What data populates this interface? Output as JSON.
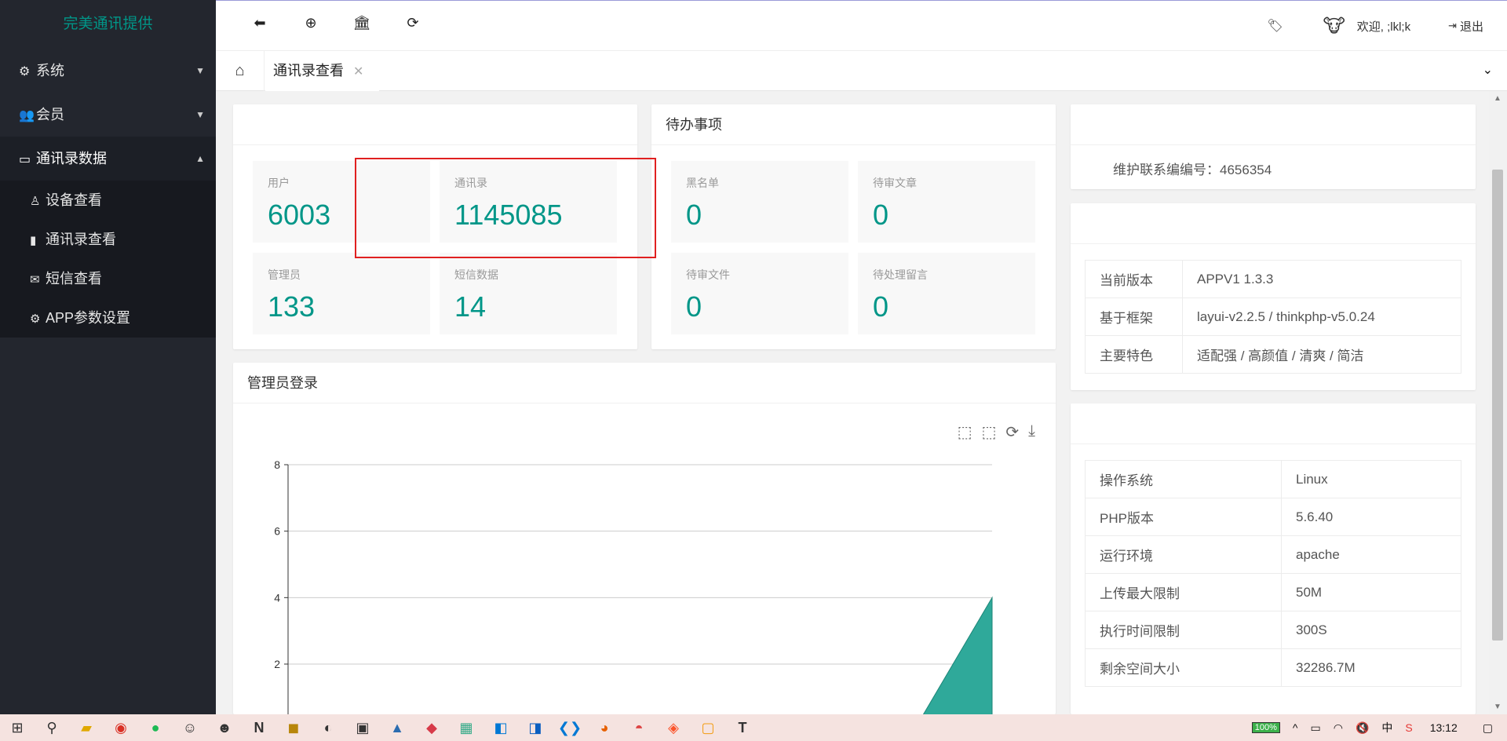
{
  "brand": "完美通讯提供",
  "sidebar": {
    "items": [
      {
        "label": "系统",
        "icon": "gear-icon"
      },
      {
        "label": "会员",
        "icon": "users-icon"
      },
      {
        "label": "通讯录数据",
        "icon": "id-card-icon"
      }
    ],
    "subitems": [
      {
        "label": "设备查看",
        "icon": "user-icon"
      },
      {
        "label": "通讯录查看",
        "icon": "building-icon"
      },
      {
        "label": "短信查看",
        "icon": "envelope-icon"
      },
      {
        "label": "APP参数设置",
        "icon": "gear-icon"
      }
    ]
  },
  "header": {
    "welcome": "欢迎, ;lkl;k",
    "logout": "退出"
  },
  "tabs": {
    "active": "通讯录查看"
  },
  "stats": [
    {
      "label": "用户",
      "value": "6003"
    },
    {
      "label": "通讯录",
      "value": "1145085"
    },
    {
      "label": "管理员",
      "value": "133"
    },
    {
      "label": "短信数据",
      "value": "14"
    }
  ],
  "todo": {
    "title": "待办事项",
    "items": [
      {
        "label": "黑名单",
        "value": "0"
      },
      {
        "label": "待审文章",
        "value": "0"
      },
      {
        "label": "待审文件",
        "value": "0"
      },
      {
        "label": "待处理留言",
        "value": "0"
      }
    ]
  },
  "contact_card": {
    "text": "维护联系编编号：4656354"
  },
  "version_table": [
    {
      "key": "当前版本",
      "value": "APPV1 1.3.3"
    },
    {
      "key": "基于框架",
      "value": "layui-v2.2.5 / thinkphp-v5.0.24"
    },
    {
      "key": "主要特色",
      "value": "适配强 / 高颜值 / 清爽 / 简洁"
    }
  ],
  "system_table": [
    {
      "key": "操作系统",
      "value": "Linux"
    },
    {
      "key": "PHP版本",
      "value": "5.6.40"
    },
    {
      "key": "运行环境",
      "value": "apache"
    },
    {
      "key": "上传最大限制",
      "value": "50M"
    },
    {
      "key": "执行时间限制",
      "value": "300S"
    },
    {
      "key": "剩余空间大小",
      "value": "32286.7M"
    }
  ],
  "admin_login": {
    "title": "管理员登录"
  },
  "chart_data": {
    "type": "area",
    "title": "管理员登录",
    "y_ticks": [
      "8",
      "6",
      "4",
      "2"
    ],
    "ylim": [
      0,
      8
    ],
    "visible_ylim": [
      2,
      8
    ],
    "grid": true,
    "series": [
      {
        "values": [
          0,
          0,
          0,
          0,
          0,
          0,
          0,
          0,
          0,
          4
        ]
      }
    ],
    "color": "#2fa99a"
  },
  "taskbar": {
    "battery": "100%",
    "ime": "中",
    "time": "13:12"
  },
  "colors": {
    "accent": "#009688",
    "sidebar": "#23262e",
    "highlight": "#e02020"
  }
}
